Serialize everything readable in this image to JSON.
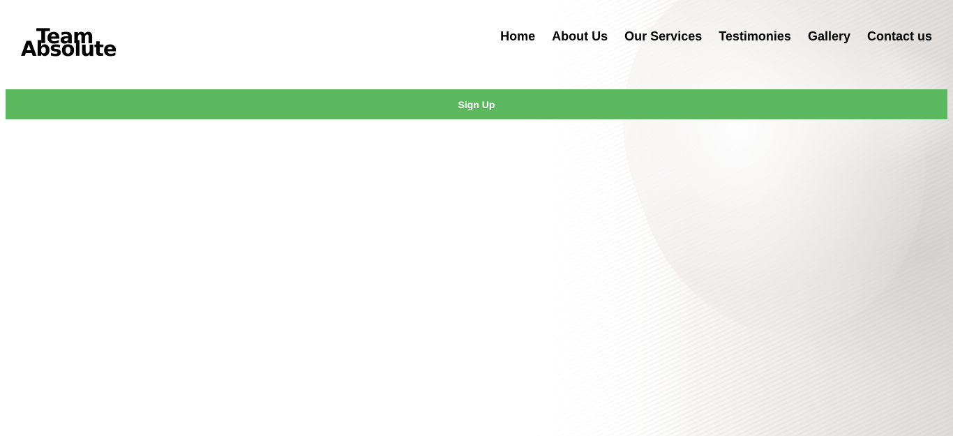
{
  "brand": {
    "logo_line1": "Team",
    "logo_line2": "Absolute"
  },
  "nav": {
    "items": [
      {
        "label": "Home"
      },
      {
        "label": "About Us"
      },
      {
        "label": "Our Services"
      },
      {
        "label": "Testimonies"
      },
      {
        "label": "Gallery"
      },
      {
        "label": "Contact us"
      }
    ]
  },
  "cta": {
    "signup_label": "Sign Up",
    "color": "#5cb85f"
  }
}
